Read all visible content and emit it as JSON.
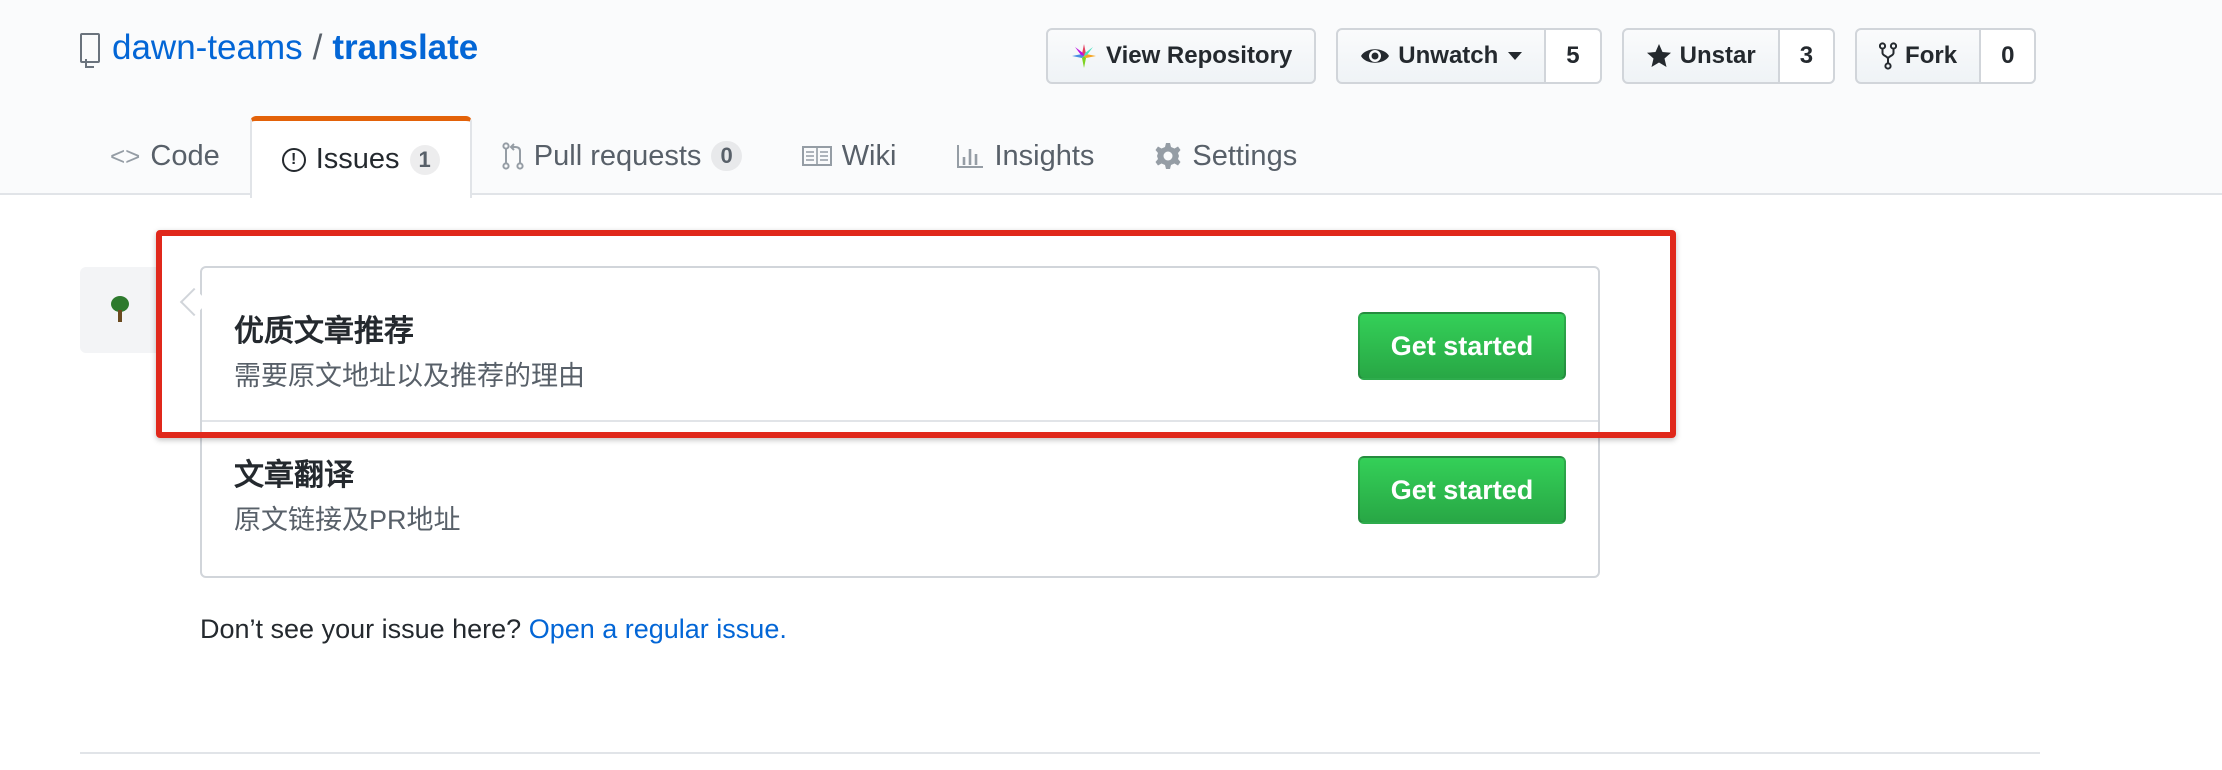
{
  "repo": {
    "owner": "dawn-teams",
    "separator": "/",
    "name": "translate"
  },
  "actions": {
    "view_repository": "View Repository",
    "watch": {
      "label": "Unwatch",
      "count": "5"
    },
    "star": {
      "label": "Unstar",
      "count": "3"
    },
    "fork": {
      "label": "Fork",
      "count": "0"
    }
  },
  "tabs": [
    {
      "label": "Code",
      "icon": "code-icon"
    },
    {
      "label": "Issues",
      "icon": "issue-opened-icon",
      "counter": "1",
      "selected": true
    },
    {
      "label": "Pull requests",
      "icon": "git-pull-request-icon",
      "counter": "0"
    },
    {
      "label": "Wiki",
      "icon": "book-icon"
    },
    {
      "label": "Insights",
      "icon": "graph-icon"
    },
    {
      "label": "Settings",
      "icon": "gear-icon"
    }
  ],
  "templates": [
    {
      "title": "优质文章推荐",
      "description": "需要原文地址以及推荐的理由",
      "button": "Get started"
    },
    {
      "title": "文章翻译",
      "description": "原文链接及PR地址",
      "button": "Get started"
    }
  ],
  "footer": {
    "text": "Don’t see your issue here? ",
    "link": "Open a regular issue."
  },
  "colors": {
    "accent_tab": "#e36209",
    "link": "#0366d6",
    "primary_button": "#28a745",
    "highlight": "#e0281b"
  }
}
